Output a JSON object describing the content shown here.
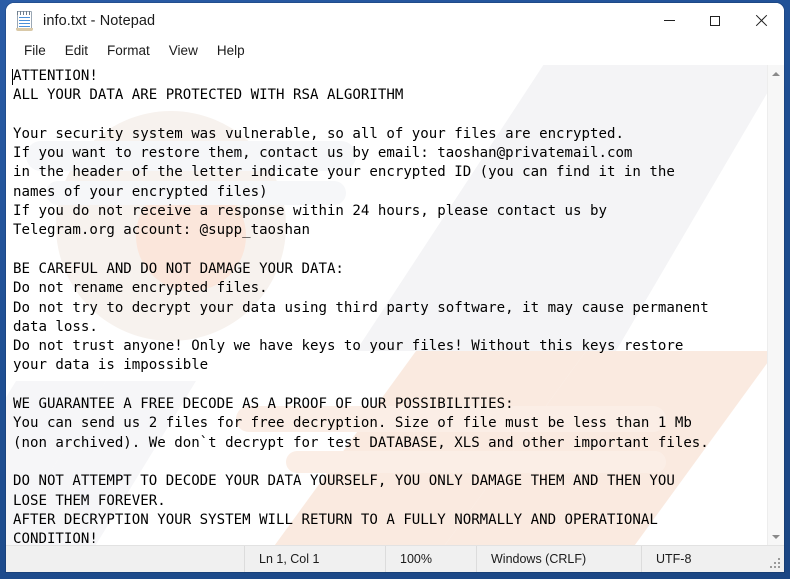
{
  "window": {
    "title": "info.txt - Notepad",
    "icon": "notepad-icon",
    "controls": {
      "minimize": "—",
      "maximize": "☐",
      "close": "✕"
    }
  },
  "menubar": {
    "items": [
      {
        "label": "File"
      },
      {
        "label": "Edit"
      },
      {
        "label": "Format"
      },
      {
        "label": "View"
      },
      {
        "label": "Help"
      }
    ]
  },
  "editor": {
    "content": "ATTENTION!\nALL YOUR DATA ARE PROTECTED WITH RSA ALGORITHM\n\nYour security system was vulnerable, so all of your files are encrypted.\nIf you want to restore them, contact us by email: taoshan@privatemail.com\nin the header of the letter indicate your encrypted ID (you can find it in the\nnames of your encrypted files)\nIf you do not receive a response within 24 hours, please contact us by\nTelegram.org account: @supp_taoshan\n\nBE CAREFUL AND DO NOT DAMAGE YOUR DATA:\nDo not rename encrypted files.\nDo not try to decrypt your data using third party software, it may cause permanent\ndata loss.\nDo not trust anyone! Only we have keys to your files! Without this keys restore\nyour data is impossible\n\nWE GUARANTEE A FREE DECODE AS A PROOF OF OUR POSSIBILITIES:\nYou can send us 2 files for free decryption. Size of file must be less than 1 Mb\n(non archived). We don`t decrypt for test DATABASE, XLS and other important files.\n\nDO NOT ATTEMPT TO DECODE YOUR DATA YOURSELF, YOU ONLY DAMAGE THEM AND THEN YOU\nLOSE THEM FOREVER.\nAFTER DECRYPTION YOUR SYSTEM WILL RETURN TO A FULLY NORMALLY AND OPERATIONAL\nCONDITION!",
    "contact_email": "taoshan@privatemail.com",
    "telegram_account": "@supp_taoshan"
  },
  "scrollbar": {
    "up_arrow": "▲",
    "down_arrow": "▼"
  },
  "statusbar": {
    "cursor_position": "Ln 1, Col 1",
    "zoom": "100%",
    "line_ending": "Windows (CRLF)",
    "encoding": "UTF-8"
  },
  "colors": {
    "desktop_blue": "#1f4c8f",
    "window_bg": "#ffffff",
    "statusbar_bg": "#f0f0f0",
    "text": "#000000",
    "watermark": "#fbe9de"
  }
}
